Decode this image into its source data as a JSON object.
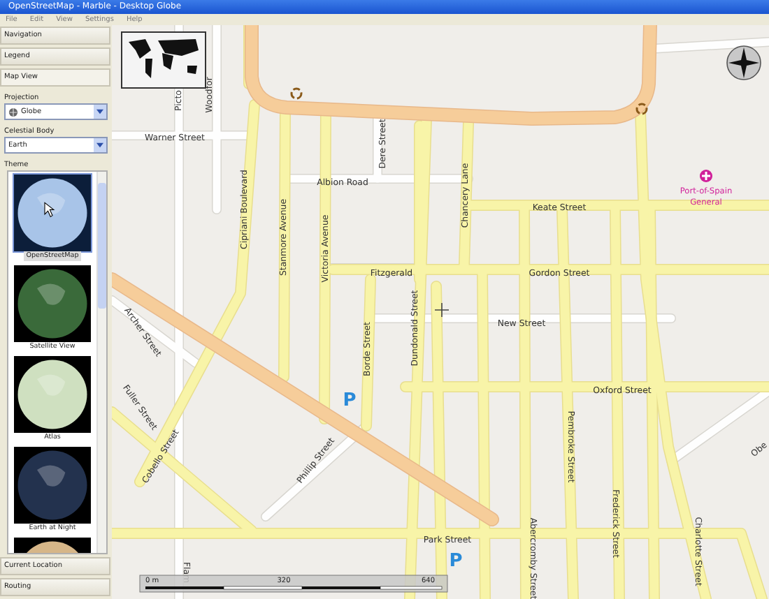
{
  "window": {
    "title": "OpenStreetMap - Marble - Desktop Globe"
  },
  "menu": [
    "File",
    "Edit",
    "View",
    "Settings",
    "Help"
  ],
  "sidebar": {
    "top_sections": [
      {
        "label": "Navigation",
        "expanded": false
      },
      {
        "label": "Legend",
        "expanded": false
      },
      {
        "label": "Map View",
        "expanded": true
      }
    ],
    "projection": {
      "label": "Projection",
      "value": "Globe"
    },
    "celestial_body": {
      "label": "Celestial Body",
      "value": "Earth"
    },
    "theme": {
      "label": "Theme",
      "items": [
        {
          "label": "OpenStreetMap",
          "kind": "street",
          "selected": true
        },
        {
          "label": "Satellite View",
          "kind": "satellite",
          "selected": false
        },
        {
          "label": "Atlas",
          "kind": "atlas",
          "selected": false
        },
        {
          "label": "Earth at Night",
          "kind": "night",
          "selected": false
        },
        {
          "kind": "historical",
          "selected": false
        }
      ]
    },
    "bottom_sections": [
      {
        "label": "Current Location",
        "expanded": false
      },
      {
        "label": "Routing",
        "expanded": false
      }
    ]
  },
  "map": {
    "labels": [
      {
        "text": "Picto",
        "kind": "street"
      },
      {
        "text": "Woodfor",
        "kind": "street"
      },
      {
        "text": "Warner Street",
        "kind": "street"
      },
      {
        "text": "Albion Road",
        "kind": "street"
      },
      {
        "text": "Dere Street",
        "kind": "street"
      },
      {
        "text": "Chancery Lane",
        "kind": "street"
      },
      {
        "text": "Keate Street",
        "kind": "street"
      },
      {
        "text": "Cipriani Boulevard",
        "kind": "street"
      },
      {
        "text": "Stanmore Avenue",
        "kind": "street"
      },
      {
        "text": "Victoria Avenue",
        "kind": "street"
      },
      {
        "text": "Fitzgerald",
        "kind": "street"
      },
      {
        "text": "Gordon Street",
        "kind": "street"
      },
      {
        "text": "Dundonald Street",
        "kind": "street"
      },
      {
        "text": "New Street",
        "kind": "street"
      },
      {
        "text": "Borde Street",
        "kind": "street"
      },
      {
        "text": "Oxford Street",
        "kind": "street"
      },
      {
        "text": "Archer Street",
        "kind": "street"
      },
      {
        "text": "Fuller Street",
        "kind": "street"
      },
      {
        "text": "Cobello Street",
        "kind": "street"
      },
      {
        "text": "Phillip Street",
        "kind": "street"
      },
      {
        "text": "Pembroke Street",
        "kind": "street"
      },
      {
        "text": "Frederick Street",
        "kind": "street"
      },
      {
        "text": "Abercromby Street",
        "kind": "street"
      },
      {
        "text": "Charlotte Street",
        "kind": "street"
      },
      {
        "text": "Park Street",
        "kind": "street"
      },
      {
        "text": "Obe",
        "kind": "street"
      },
      {
        "text": "Flam",
        "kind": "street"
      },
      {
        "text": "Port-of-Spain",
        "kind": "poi"
      },
      {
        "text": "General",
        "kind": "poi"
      },
      {
        "text": "P",
        "kind": "parking"
      },
      {
        "text": "P",
        "kind": "parking"
      }
    ],
    "scale_bar": {
      "labels": [
        "0 m",
        "320",
        "640"
      ]
    }
  }
}
